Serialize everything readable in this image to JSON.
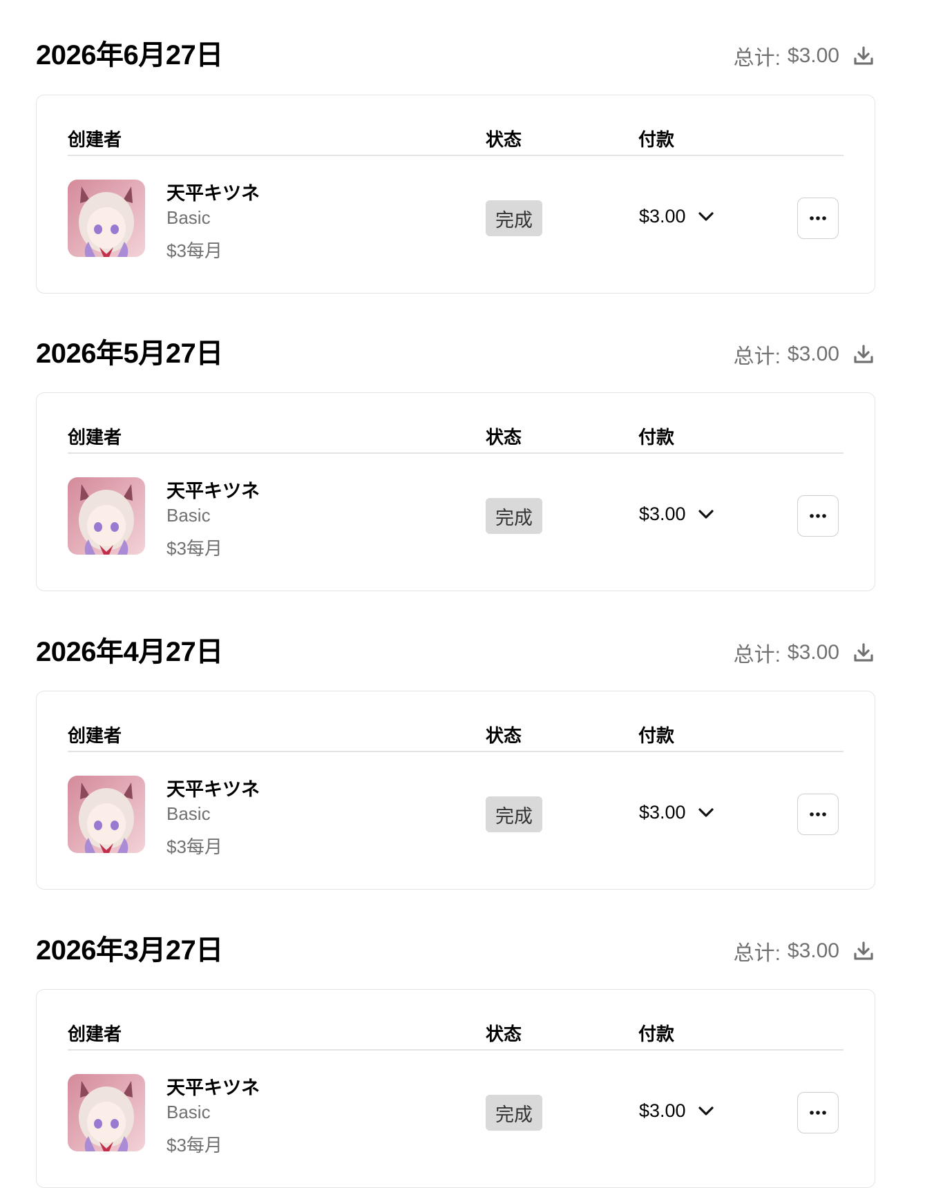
{
  "table_headers": {
    "creator": "创建者",
    "status": "状态",
    "payment": "付款"
  },
  "total_label": "总计:",
  "sections": [
    {
      "date": "2026年6月27日",
      "total": "$3.00",
      "row": {
        "creator": "天平キツネ",
        "tier": "Basic",
        "price": "$3每月",
        "status": "完成",
        "amount": "$3.00"
      }
    },
    {
      "date": "2026年5月27日",
      "total": "$3.00",
      "row": {
        "creator": "天平キツネ",
        "tier": "Basic",
        "price": "$3每月",
        "status": "完成",
        "amount": "$3.00"
      }
    },
    {
      "date": "2026年4月27日",
      "total": "$3.00",
      "row": {
        "creator": "天平キツネ",
        "tier": "Basic",
        "price": "$3每月",
        "status": "完成",
        "amount": "$3.00"
      }
    },
    {
      "date": "2026年3月27日",
      "total": "$3.00",
      "row": {
        "creator": "天平キツネ",
        "tier": "Basic",
        "price": "$3每月",
        "status": "完成",
        "amount": "$3.00"
      }
    }
  ],
  "icons": {
    "download": "download-icon",
    "chevron": "chevron-down-icon",
    "more": "ellipsis-icon"
  }
}
